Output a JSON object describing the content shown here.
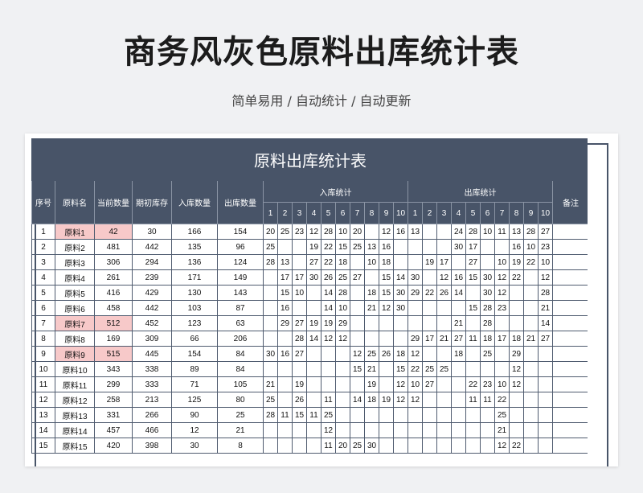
{
  "page": {
    "title": "商务风灰色原料出库统计表",
    "subtitle": "简单易用 / 自动统计 / 自动更新"
  },
  "table": {
    "title": "原料出库统计表",
    "headers": {
      "seq": "序号",
      "name": "原料名",
      "current": "当前数量",
      "opening": "期初库存",
      "in_qty": "入库数量",
      "out_qty": "出库数量",
      "in_stats": "入库统计",
      "out_stats": "出库统计",
      "remark": "备注"
    },
    "day_numbers": [
      "1",
      "2",
      "3",
      "4",
      "5",
      "6",
      "7",
      "8",
      "9",
      "10"
    ],
    "highlight_color": "#f7c9c9",
    "header_color": "#485468",
    "rows": [
      {
        "seq": "1",
        "name": "原料1",
        "current": "42",
        "opening": "30",
        "in_qty": "166",
        "out_qty": "154",
        "highlight": true,
        "in": [
          "20",
          "25",
          "23",
          "12",
          "28",
          "10",
          "20",
          "",
          "12",
          "16"
        ],
        "out": [
          "13",
          "",
          "",
          "24",
          "28",
          "10",
          "11",
          "13",
          "28",
          "27"
        ],
        "remark": ""
      },
      {
        "seq": "2",
        "name": "原料2",
        "current": "481",
        "opening": "442",
        "in_qty": "135",
        "out_qty": "96",
        "highlight": false,
        "in": [
          "25",
          "",
          "",
          "19",
          "22",
          "15",
          "25",
          "13",
          "16",
          ""
        ],
        "out": [
          "",
          "",
          "",
          "30",
          "17",
          "",
          "",
          "16",
          "10",
          "23"
        ],
        "remark": ""
      },
      {
        "seq": "3",
        "name": "原料3",
        "current": "306",
        "opening": "294",
        "in_qty": "136",
        "out_qty": "124",
        "highlight": false,
        "in": [
          "28",
          "13",
          "",
          "27",
          "22",
          "18",
          "",
          "10",
          "18",
          ""
        ],
        "out": [
          "",
          "19",
          "17",
          "",
          "27",
          "",
          "10",
          "19",
          "22",
          "10"
        ],
        "remark": ""
      },
      {
        "seq": "4",
        "name": "原料4",
        "current": "261",
        "opening": "239",
        "in_qty": "171",
        "out_qty": "149",
        "highlight": false,
        "in": [
          "",
          "17",
          "17",
          "30",
          "26",
          "25",
          "27",
          "",
          "15",
          "14"
        ],
        "out": [
          "30",
          "",
          "12",
          "16",
          "15",
          "30",
          "12",
          "22",
          "",
          "12"
        ],
        "remark": ""
      },
      {
        "seq": "5",
        "name": "原料5",
        "current": "416",
        "opening": "429",
        "in_qty": "130",
        "out_qty": "143",
        "highlight": false,
        "in": [
          "",
          "15",
          "10",
          "",
          "14",
          "28",
          "",
          "18",
          "15",
          "30"
        ],
        "out": [
          "29",
          "22",
          "26",
          "14",
          "",
          "30",
          "12",
          "",
          "",
          "28"
        ],
        "remark": ""
      },
      {
        "seq": "6",
        "name": "原料6",
        "current": "458",
        "opening": "442",
        "in_qty": "103",
        "out_qty": "87",
        "highlight": false,
        "in": [
          "",
          "16",
          "",
          "",
          "14",
          "10",
          "",
          "21",
          "12",
          "30"
        ],
        "out": [
          "",
          "",
          "",
          "",
          "15",
          "28",
          "23",
          "",
          "",
          "21"
        ],
        "remark": ""
      },
      {
        "seq": "7",
        "name": "原料7",
        "current": "512",
        "opening": "452",
        "in_qty": "123",
        "out_qty": "63",
        "highlight": true,
        "in": [
          "",
          "29",
          "27",
          "19",
          "19",
          "29",
          "",
          "",
          "",
          ""
        ],
        "out": [
          "",
          "",
          "",
          "21",
          "",
          "28",
          "",
          "",
          "",
          "14"
        ],
        "remark": ""
      },
      {
        "seq": "8",
        "name": "原料8",
        "current": "169",
        "opening": "309",
        "in_qty": "66",
        "out_qty": "206",
        "highlight": false,
        "in": [
          "",
          "",
          "28",
          "14",
          "12",
          "12",
          "",
          "",
          "",
          ""
        ],
        "out": [
          "29",
          "17",
          "21",
          "27",
          "11",
          "18",
          "17",
          "18",
          "21",
          "27"
        ],
        "remark": ""
      },
      {
        "seq": "9",
        "name": "原料9",
        "current": "515",
        "opening": "445",
        "in_qty": "154",
        "out_qty": "84",
        "highlight": true,
        "in": [
          "30",
          "16",
          "27",
          "",
          "",
          "",
          "12",
          "25",
          "26",
          "18"
        ],
        "out": [
          "12",
          "",
          "",
          "18",
          "",
          "25",
          "",
          "29",
          "",
          ""
        ],
        "remark": ""
      },
      {
        "seq": "10",
        "name": "原料10",
        "current": "343",
        "opening": "338",
        "in_qty": "89",
        "out_qty": "84",
        "highlight": false,
        "in": [
          "",
          "",
          "",
          "",
          "",
          "",
          "15",
          "21",
          "",
          "15"
        ],
        "out": [
          "22",
          "25",
          "25",
          "",
          "",
          "",
          "",
          "12",
          "",
          ""
        ],
        "remark": ""
      },
      {
        "seq": "11",
        "name": "原料11",
        "current": "299",
        "opening": "333",
        "in_qty": "71",
        "out_qty": "105",
        "highlight": false,
        "in": [
          "21",
          "",
          "19",
          "",
          "",
          "",
          "",
          "19",
          "",
          "12"
        ],
        "out": [
          "10",
          "27",
          "",
          "",
          "22",
          "23",
          "10",
          "12",
          "",
          ""
        ],
        "remark": ""
      },
      {
        "seq": "12",
        "name": "原料12",
        "current": "258",
        "opening": "213",
        "in_qty": "125",
        "out_qty": "80",
        "highlight": false,
        "in": [
          "25",
          "",
          "26",
          "",
          "11",
          "",
          "14",
          "18",
          "19",
          "12"
        ],
        "out": [
          "12",
          "",
          "",
          "",
          "11",
          "11",
          "22",
          "",
          "",
          ""
        ],
        "remark": ""
      },
      {
        "seq": "13",
        "name": "原料13",
        "current": "331",
        "opening": "266",
        "in_qty": "90",
        "out_qty": "25",
        "highlight": false,
        "in": [
          "28",
          "11",
          "15",
          "11",
          "25",
          "",
          "",
          "",
          "",
          ""
        ],
        "out": [
          "",
          "",
          "",
          "",
          "",
          "",
          "25",
          "",
          "",
          ""
        ],
        "remark": ""
      },
      {
        "seq": "14",
        "name": "原料14",
        "current": "457",
        "opening": "466",
        "in_qty": "12",
        "out_qty": "21",
        "highlight": false,
        "in": [
          "",
          "",
          "",
          "",
          "12",
          "",
          "",
          "",
          "",
          ""
        ],
        "out": [
          "",
          "",
          "",
          "",
          "",
          "",
          "21",
          "",
          "",
          ""
        ],
        "remark": ""
      },
      {
        "seq": "15",
        "name": "原料15",
        "current": "420",
        "opening": "398",
        "in_qty": "30",
        "out_qty": "8",
        "highlight": false,
        "in": [
          "",
          "",
          "",
          "",
          "11",
          "20",
          "25",
          "30",
          "",
          ""
        ],
        "out": [
          "",
          "",
          "",
          "",
          "",
          "",
          "12",
          "22",
          "",
          ""
        ],
        "remark": ""
      }
    ]
  }
}
